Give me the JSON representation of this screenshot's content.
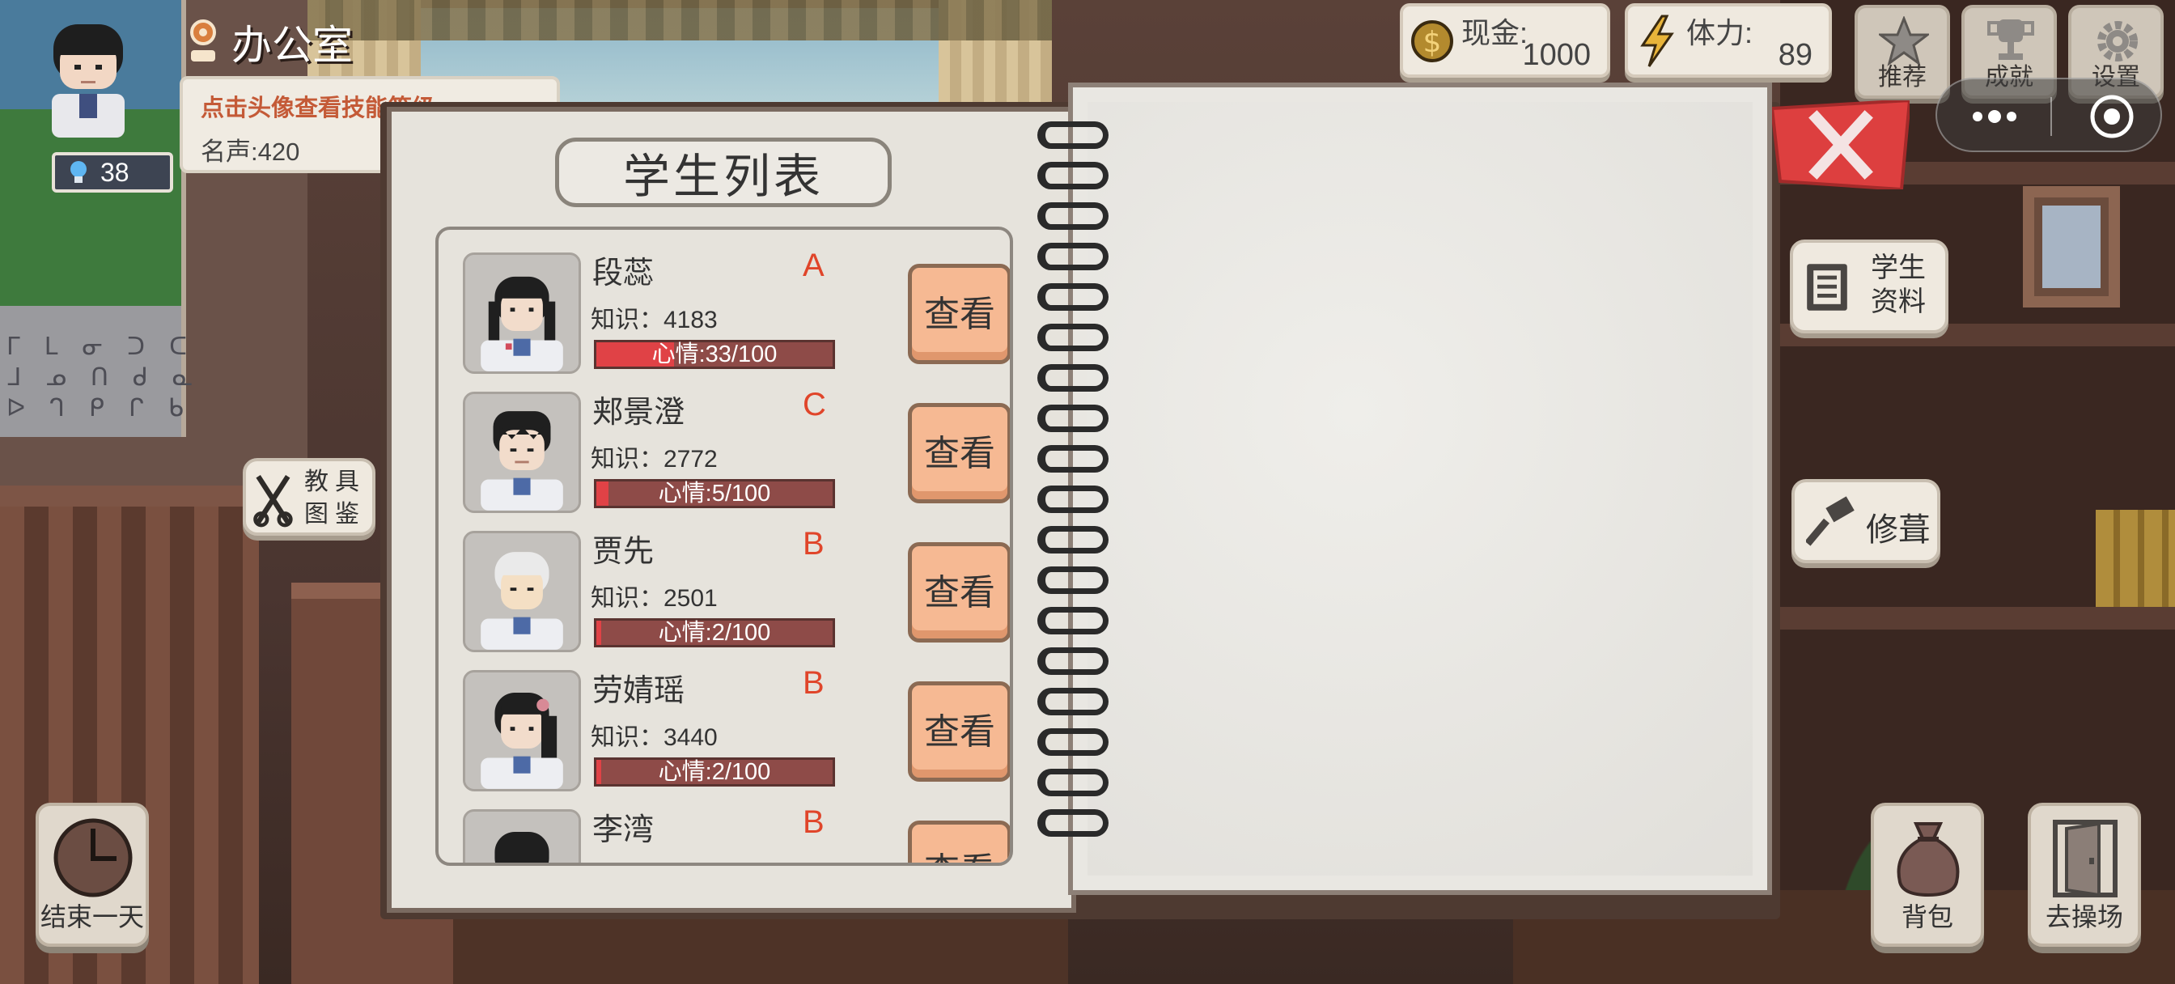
{
  "location": {
    "name": "办公室"
  },
  "player": {
    "level": "38",
    "hint": "点击头像查看技能等级",
    "fame": "名声:420"
  },
  "stats": {
    "cash_label": "现金:",
    "cash_value": "1000",
    "stamina_label": "体力:",
    "stamina_value": "89"
  },
  "corner_buttons": {
    "recommend": "推荐",
    "achievements": "成就",
    "settings": "设置"
  },
  "notebook": {
    "title": "学生列表"
  },
  "students": [
    {
      "name": "段蕊",
      "grade": "A",
      "knowledge": "知识：4183",
      "mood_label": "心情:33/100",
      "mood": 0.33,
      "button": "查看"
    },
    {
      "name": "郏景澄",
      "grade": "C",
      "knowledge": "知识：2772",
      "mood_label": "心情:5/100",
      "mood": 0.05,
      "button": "查看"
    },
    {
      "name": "贾先",
      "grade": "B",
      "knowledge": "知识：2501",
      "mood_label": "心情:2/100",
      "mood": 0.02,
      "button": "查看"
    },
    {
      "name": "劳婧瑶",
      "grade": "B",
      "knowledge": "知识：3440",
      "mood_label": "心情:2/100",
      "mood": 0.02,
      "button": "查看"
    },
    {
      "name": "李湾",
      "grade": "B",
      "knowledge": "",
      "mood_label": "",
      "mood": 0,
      "button": "查看"
    }
  ],
  "side": {
    "student_info": "学生资料",
    "repair": "修葺",
    "teaching_tools": "教具图鉴"
  },
  "bottom": {
    "end_day": "结束一天",
    "bag": "背包",
    "playground": "去操场"
  },
  "poster": {
    "letters": "ᒥ ᒪ ᓂ ᑐ ᑕ\nᒧ ᓄ ᑎ ᑯ ᓇ\nᐅ ᒉ ᑭ ᒋ ᑲ"
  },
  "colors": {
    "grade_text": "#e0452a",
    "mood_fill": "#e04246",
    "view_button": "#f6b993",
    "close_flag": "#dd3f3f"
  }
}
